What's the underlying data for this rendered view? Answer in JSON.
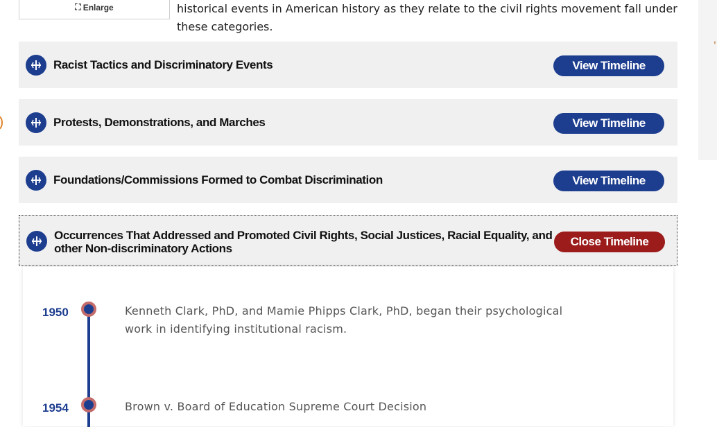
{
  "enlarge": {
    "label": "Enlarge",
    "icon": "enlarge-icon"
  },
  "intro": {
    "text": "historical events in American history as they relate to the civil rights movement fall under these categories."
  },
  "categories": [
    {
      "title": "Racist Tactics and Discriminatory Events",
      "button": "View Timeline",
      "state": "collapsed"
    },
    {
      "title": "Protests, Demonstrations, and Marches",
      "button": "View Timeline",
      "state": "collapsed"
    },
    {
      "title": "Foundations/Commissions Formed to Combat Discrimination",
      "button": "View Timeline",
      "state": "collapsed"
    },
    {
      "title": "Occurrences That Addressed and Promoted Civil Rights, Social Justices, Racial Equality, and other Non-discriminatory Actions",
      "button": "Close Timeline",
      "state": "expanded"
    }
  ],
  "timeline": [
    {
      "year": "1950",
      "text": "Kenneth Clark, PhD, and Mamie Phipps Clark, PhD, began their psychological work in identifying institutional racism."
    },
    {
      "year": "1954",
      "text": "Brown v. Board of Education Supreme Court Decision"
    }
  ],
  "colors": {
    "navy": "#1d3e8f",
    "red": "#9c1c1c",
    "panel": "#f0f0f0",
    "dot_ring": "#c46b6b"
  }
}
